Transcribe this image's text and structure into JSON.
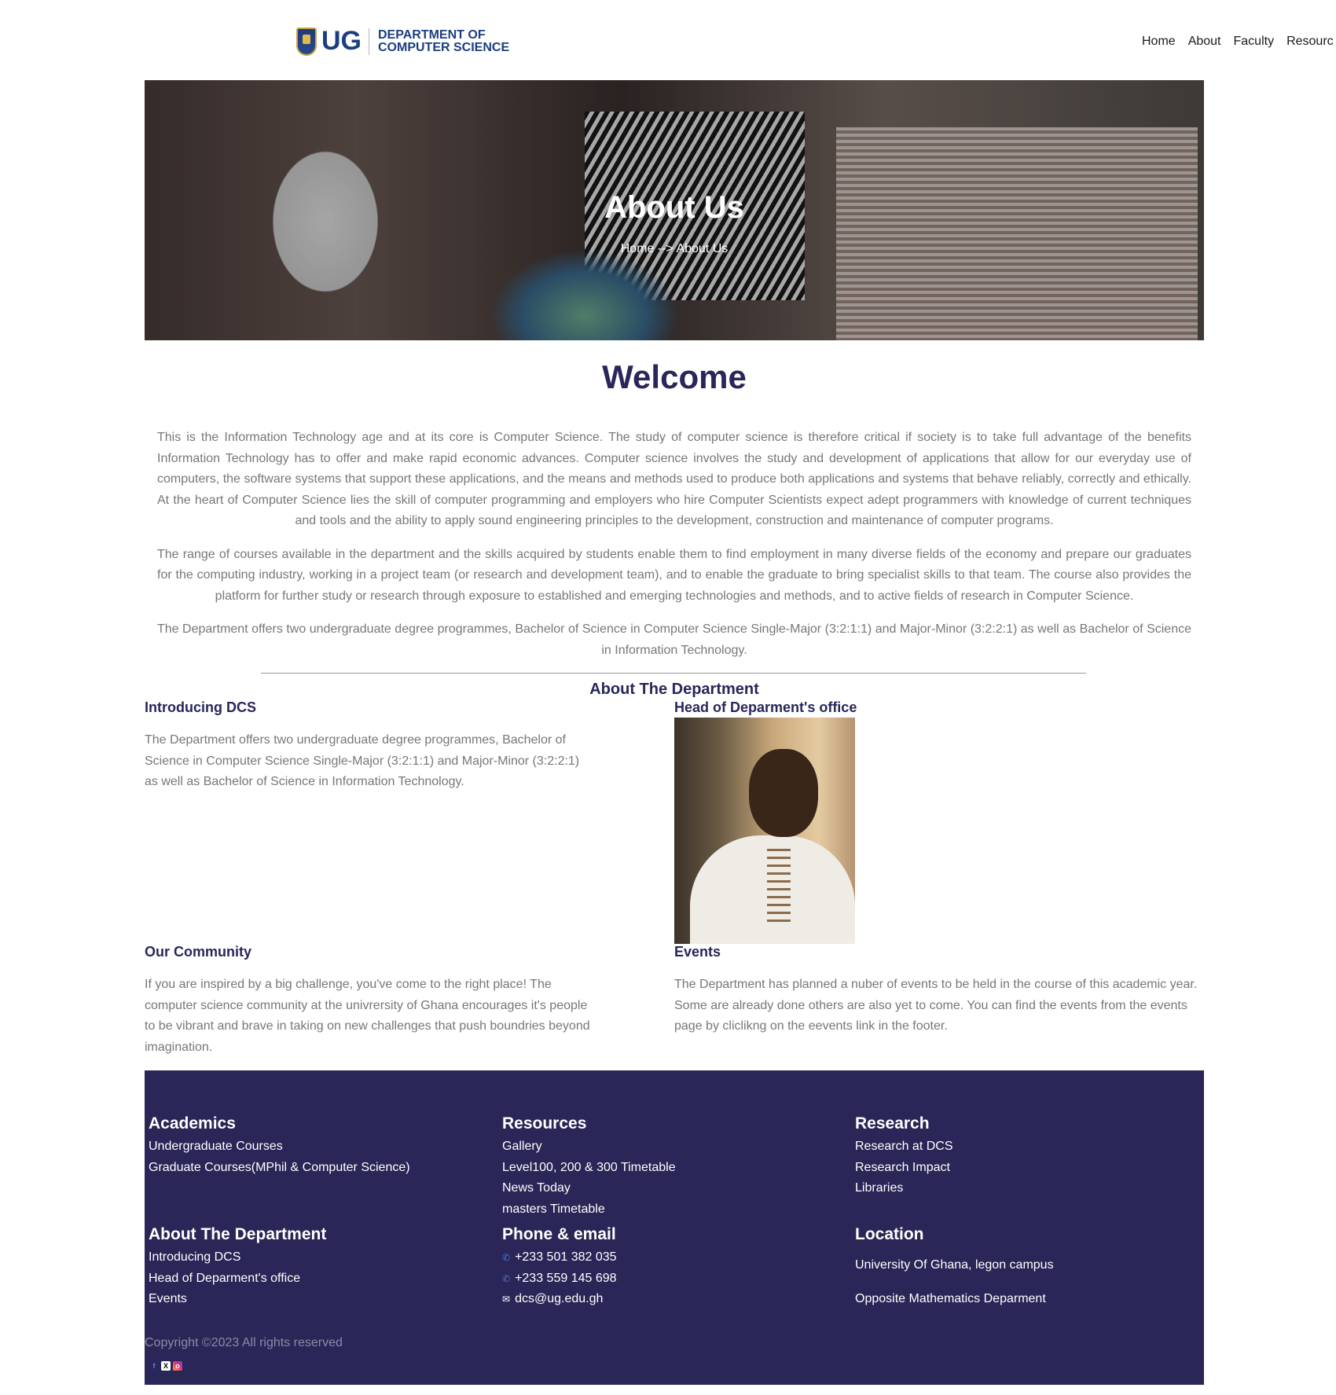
{
  "header": {
    "logo_text": "UG",
    "dept_line1": "DEPARTMENT OF",
    "dept_line2": "COMPUTER SCIENCE",
    "nav": [
      "Home",
      "About",
      "Faculty",
      "Resourc"
    ]
  },
  "hero": {
    "title": "About Us",
    "breadcrumb": "Home --> About Us"
  },
  "welcome": {
    "title": "Welcome",
    "paragraphs": [
      "This is the Information Technology age and at its core is Computer Science. The study of computer science is therefore critical if society is to take full advantage of the benefits Information Technology has to offer and make rapid economic advances. Computer science involves the study and development of applications that allow for our everyday use of computers, the software systems that support these applications, and the means and methods used to produce both applications and systems that behave reliably, correctly and ethically. At the heart of Computer Science lies the skill of computer programming and employers who hire Computer Scientists expect adept programmers with knowledge of current techniques and tools and the ability to apply sound engineering principles to the development, construction and maintenance of computer programs.",
      "The range of courses available in the department and the skills acquired by students enable them to find employment in many diverse fields of the economy and prepare our graduates for the computing industry, working in a project team (or research and development team), and to enable the graduate to bring specialist skills to that team. The course also provides the platform for further study or research through exposure to established and emerging technologies and methods, and to active fields of research in Computer Science.",
      "The Department offers two undergraduate degree programmes, Bachelor of Science in Computer Science Single-Major (3:2:1:1) and Major-Minor (3:2:2:1) as well as Bachelor of Science in Information Technology."
    ]
  },
  "about": {
    "title": "About The Department",
    "introducing_title": "Introducing DCS",
    "introducing_text": "The Department offers two undergraduate degree programmes, Bachelor of Science in Computer Science Single-Major (3:2:1:1) and Major-Minor (3:2:2:1) as well as Bachelor of Science in Information Technology.",
    "hod_title": "Head of Deparment's office",
    "community_title": "Our Community",
    "community_text": "If you are inspired by a big challenge, you've come to the right place! The computer science community at the univrersity of Ghana encourages it's people to be vibrant and brave in taking on new challenges that push boundries beyond imagination.",
    "events_title": "Events",
    "events_text": "The Department has planned a nuber of events to be held in the course of this academic year. Some are already done others are also yet to come. You can find the events from the events page by cliclikng on the eevents link in the footer."
  },
  "footer": {
    "academics": {
      "title": "Academics",
      "links": [
        "Undergraduate Courses",
        "Graduate Courses(MPhil & Computer Science)"
      ]
    },
    "resources": {
      "title": "Resources",
      "links": [
        "Gallery",
        "Level100, 200 & 300 Timetable",
        "News Today",
        "masters Timetable"
      ]
    },
    "research": {
      "title": "Research",
      "links": [
        "Research at DCS",
        "Research Impact",
        "Libraries"
      ]
    },
    "about": {
      "title": "About The Department",
      "links": [
        "Introducing DCS",
        "Head of Deparment's office",
        "Events"
      ]
    },
    "contact": {
      "title": "Phone & email",
      "phone1": "+233 501 382 035",
      "phone2": "+233 559 145 698",
      "email": "dcs@ug.edu.gh"
    },
    "location": {
      "title": "Location",
      "line1": "University Of Ghana, legon campus",
      "line2": "Opposite Mathematics Deparment"
    },
    "copyright": "Copyright ©2023 All rights reserved",
    "social_icons": [
      "facebook-icon",
      "x-icon",
      "instagram-icon"
    ]
  }
}
